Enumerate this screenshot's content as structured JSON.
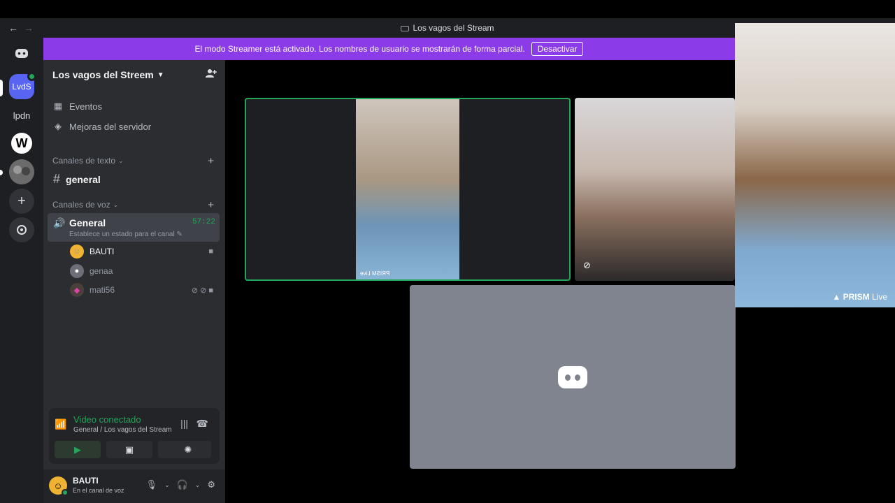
{
  "window": {
    "title": "Los vagos del Stream"
  },
  "banner": {
    "text": "El modo Streamer está activado. Los nombres de usuario se mostrarán de forma parcial.",
    "button": "Desactivar"
  },
  "rail": {
    "lvds": "LvdS",
    "lpdn": "lpdn",
    "wiki": "W"
  },
  "guild": {
    "name": "Los vagos del Streem"
  },
  "links": {
    "events": "Eventos",
    "boost": "Mejoras del servidor"
  },
  "categories": {
    "text": "Canales de texto",
    "voice": "Canales de voz"
  },
  "text_channel": {
    "name": "general"
  },
  "voice_channel": {
    "name": "General",
    "timer": "57:22",
    "status": "Establece un estado para el canal"
  },
  "voice_users": [
    {
      "name": "BAUTI"
    },
    {
      "name": "genaa"
    },
    {
      "name": "mati56"
    }
  ],
  "connection": {
    "title": "Video conectado",
    "subtitle": "General / Los vagos del Stream"
  },
  "user": {
    "name": "BAUTI",
    "state": "En el canal de voz"
  },
  "stage": {
    "watermark": "PRISM Live"
  },
  "camera": {
    "brand": "PRISM",
    "brand_suffix": "Live"
  },
  "colors": {
    "accent": "#5865f2",
    "online": "#23a55a",
    "banner": "#8c3be8"
  }
}
